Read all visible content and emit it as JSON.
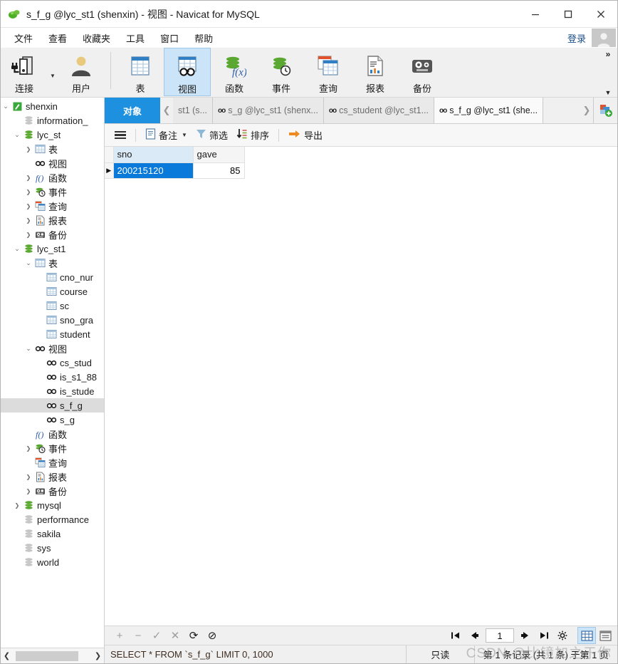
{
  "window": {
    "title": "s_f_g @lyc_st1 (shenxin) - 视图 - Navicat for MySQL",
    "logo_icon": "navicat-logo-icon",
    "minimize_icon": "minimize-icon",
    "maximize_icon": "maximize-icon",
    "close_icon": "close-icon"
  },
  "menubar": {
    "items": [
      {
        "label": "文件"
      },
      {
        "label": "查看"
      },
      {
        "label": "收藏夹"
      },
      {
        "label": "工具"
      },
      {
        "label": "窗口"
      },
      {
        "label": "帮助"
      }
    ],
    "login_label": "登录",
    "avatar_icon": "user-avatar-icon",
    "overflow_icon": "chevron-double-right-icon"
  },
  "toolbar": {
    "groups": [
      {
        "buttons": [
          {
            "label": "连接",
            "icon": "connection-icon",
            "active": false,
            "has_caret": true
          },
          {
            "label": "用户",
            "icon": "user-icon",
            "active": false,
            "has_caret": false
          }
        ]
      },
      {
        "buttons": [
          {
            "label": "表",
            "icon": "table-icon",
            "active": false,
            "has_caret": false
          },
          {
            "label": "视图",
            "icon": "view-icon",
            "active": true,
            "has_caret": false
          },
          {
            "label": "函数",
            "icon": "function-icon",
            "active": false,
            "has_caret": false
          },
          {
            "label": "事件",
            "icon": "event-icon",
            "active": false,
            "has_caret": false
          },
          {
            "label": "查询",
            "icon": "query-icon",
            "active": false,
            "has_caret": false
          },
          {
            "label": "报表",
            "icon": "report-icon",
            "active": false,
            "has_caret": false
          },
          {
            "label": "备份",
            "icon": "backup-icon",
            "active": false,
            "has_caret": false
          }
        ]
      }
    ],
    "overflow_up_icon": "chevron-double-right-icon",
    "overflow_down_icon": "chevron-down-icon"
  },
  "sidebar": {
    "nodes": [
      {
        "label": "shenxin",
        "indent": 0,
        "arrow": "down",
        "icon": "connection-green-icon",
        "selected": false
      },
      {
        "label": "information_",
        "indent": 1,
        "arrow": "none",
        "icon": "db-gray-icon",
        "selected": false
      },
      {
        "label": "lyc_st",
        "indent": 1,
        "arrow": "down",
        "icon": "db-green-icon",
        "selected": false
      },
      {
        "label": "表",
        "indent": 2,
        "arrow": "right",
        "icon": "table-icon",
        "selected": false
      },
      {
        "label": "视图",
        "indent": 2,
        "arrow": "none",
        "icon": "view-icon",
        "selected": false
      },
      {
        "label": "函数",
        "indent": 2,
        "arrow": "right",
        "icon": "function-icon",
        "selected": false
      },
      {
        "label": "事件",
        "indent": 2,
        "arrow": "right",
        "icon": "event-icon",
        "selected": false
      },
      {
        "label": "查询",
        "indent": 2,
        "arrow": "right",
        "icon": "query-icon",
        "selected": false
      },
      {
        "label": "报表",
        "indent": 2,
        "arrow": "right",
        "icon": "report-icon",
        "selected": false
      },
      {
        "label": "备份",
        "indent": 2,
        "arrow": "right",
        "icon": "backup-icon",
        "selected": false
      },
      {
        "label": "lyc_st1",
        "indent": 1,
        "arrow": "down",
        "icon": "db-green-icon",
        "selected": false
      },
      {
        "label": "表",
        "indent": 2,
        "arrow": "down",
        "icon": "table-icon",
        "selected": false
      },
      {
        "label": "cno_nur",
        "indent": 3,
        "arrow": "none",
        "icon": "table-icon",
        "selected": false
      },
      {
        "label": "course",
        "indent": 3,
        "arrow": "none",
        "icon": "table-icon",
        "selected": false
      },
      {
        "label": "sc",
        "indent": 3,
        "arrow": "none",
        "icon": "table-icon",
        "selected": false
      },
      {
        "label": "sno_gra",
        "indent": 3,
        "arrow": "none",
        "icon": "table-icon",
        "selected": false
      },
      {
        "label": "student",
        "indent": 3,
        "arrow": "none",
        "icon": "table-icon",
        "selected": false
      },
      {
        "label": "视图",
        "indent": 2,
        "arrow": "down",
        "icon": "view-icon",
        "selected": false
      },
      {
        "label": "cs_stud",
        "indent": 3,
        "arrow": "none",
        "icon": "view-icon",
        "selected": false
      },
      {
        "label": "is_s1_88",
        "indent": 3,
        "arrow": "none",
        "icon": "view-icon",
        "selected": false
      },
      {
        "label": "is_stude",
        "indent": 3,
        "arrow": "none",
        "icon": "view-icon",
        "selected": false
      },
      {
        "label": "s_f_g",
        "indent": 3,
        "arrow": "none",
        "icon": "view-icon",
        "selected": true
      },
      {
        "label": "s_g",
        "indent": 3,
        "arrow": "none",
        "icon": "view-icon",
        "selected": false
      },
      {
        "label": "函数",
        "indent": 2,
        "arrow": "none",
        "icon": "function-icon",
        "selected": false
      },
      {
        "label": "事件",
        "indent": 2,
        "arrow": "right",
        "icon": "event-icon",
        "selected": false
      },
      {
        "label": "查询",
        "indent": 2,
        "arrow": "none",
        "icon": "query-icon",
        "selected": false
      },
      {
        "label": "报表",
        "indent": 2,
        "arrow": "right",
        "icon": "report-icon",
        "selected": false
      },
      {
        "label": "备份",
        "indent": 2,
        "arrow": "right",
        "icon": "backup-icon",
        "selected": false
      },
      {
        "label": "mysql",
        "indent": 1,
        "arrow": "right",
        "icon": "db-green-icon",
        "selected": false
      },
      {
        "label": "performance",
        "indent": 1,
        "arrow": "none",
        "icon": "db-gray-icon",
        "selected": false
      },
      {
        "label": "sakila",
        "indent": 1,
        "arrow": "none",
        "icon": "db-gray-icon",
        "selected": false
      },
      {
        "label": "sys",
        "indent": 1,
        "arrow": "none",
        "icon": "db-gray-icon",
        "selected": false
      },
      {
        "label": "world",
        "indent": 1,
        "arrow": "none",
        "icon": "db-gray-icon",
        "selected": false
      }
    ],
    "scroll_left_icon": "chevron-left-icon",
    "scroll_right_icon": "chevron-right-icon"
  },
  "tabbar": {
    "objects_label": "对象",
    "prev_icon": "chevron-left-icon",
    "next_icon": "chevron-right-icon",
    "add_icon": "add-object-icon",
    "tabs": [
      {
        "label": "st1 (s...",
        "icon": "none",
        "active": false
      },
      {
        "label": "s_g @lyc_st1 (shenx...",
        "icon": "view-icon",
        "active": false
      },
      {
        "label": "cs_student @lyc_st1...",
        "icon": "view-icon",
        "active": false
      },
      {
        "label": "s_f_g @lyc_st1 (she...",
        "icon": "view-icon",
        "active": true
      }
    ]
  },
  "subtoolbar": {
    "menu_icon": "hamburger-icon",
    "buttons": [
      {
        "label": "备注",
        "icon": "note-icon",
        "caret": true
      },
      {
        "label": "筛选",
        "icon": "filter-icon",
        "caret": false
      },
      {
        "label": "排序",
        "icon": "sort-icon",
        "caret": false
      },
      {
        "label": "导出",
        "icon": "export-icon",
        "caret": false
      }
    ]
  },
  "grid": {
    "columns": [
      "sno",
      "gave"
    ],
    "selected_column": "sno",
    "rows": [
      {
        "indicator": "current-row-icon",
        "sno": "200215120",
        "gave": "85"
      }
    ]
  },
  "actionbar": {
    "buttons": [
      {
        "icon": "plus-icon",
        "label": "+",
        "enabled": false
      },
      {
        "icon": "minus-icon",
        "label": "−",
        "enabled": false
      },
      {
        "icon": "check-icon",
        "label": "✓",
        "enabled": false
      },
      {
        "icon": "cross-icon",
        "label": "✕",
        "enabled": false
      },
      {
        "icon": "refresh-icon",
        "label": "⟳",
        "enabled": true
      },
      {
        "icon": "stop-icon",
        "label": "⊘",
        "enabled": true
      }
    ],
    "pager": {
      "first_icon": "first-page-icon",
      "prev_icon": "prev-page-icon",
      "page_value": "1",
      "next_icon": "next-page-icon",
      "last_icon": "last-page-icon",
      "settings_icon": "gear-icon"
    },
    "view_modes": [
      {
        "icon": "grid-view-icon",
        "active": true
      },
      {
        "icon": "form-view-icon",
        "active": false
      }
    ]
  },
  "statusbar": {
    "sql": "SELECT * FROM `s_f_g` LIMIT 0, 1000",
    "readonly": "只读",
    "records": "第 1 条记录 (共 1 条) 于第 1 页",
    "watermark": "CSDN @比镜加之于你"
  },
  "colors": {
    "accent_blue": "#1e90e0",
    "selection_blue": "#0a7ada",
    "toolbar_bg": "#f0f0f0",
    "active_tool_bg": "#cce4f7",
    "tree_selected": "#dcdcdc"
  }
}
